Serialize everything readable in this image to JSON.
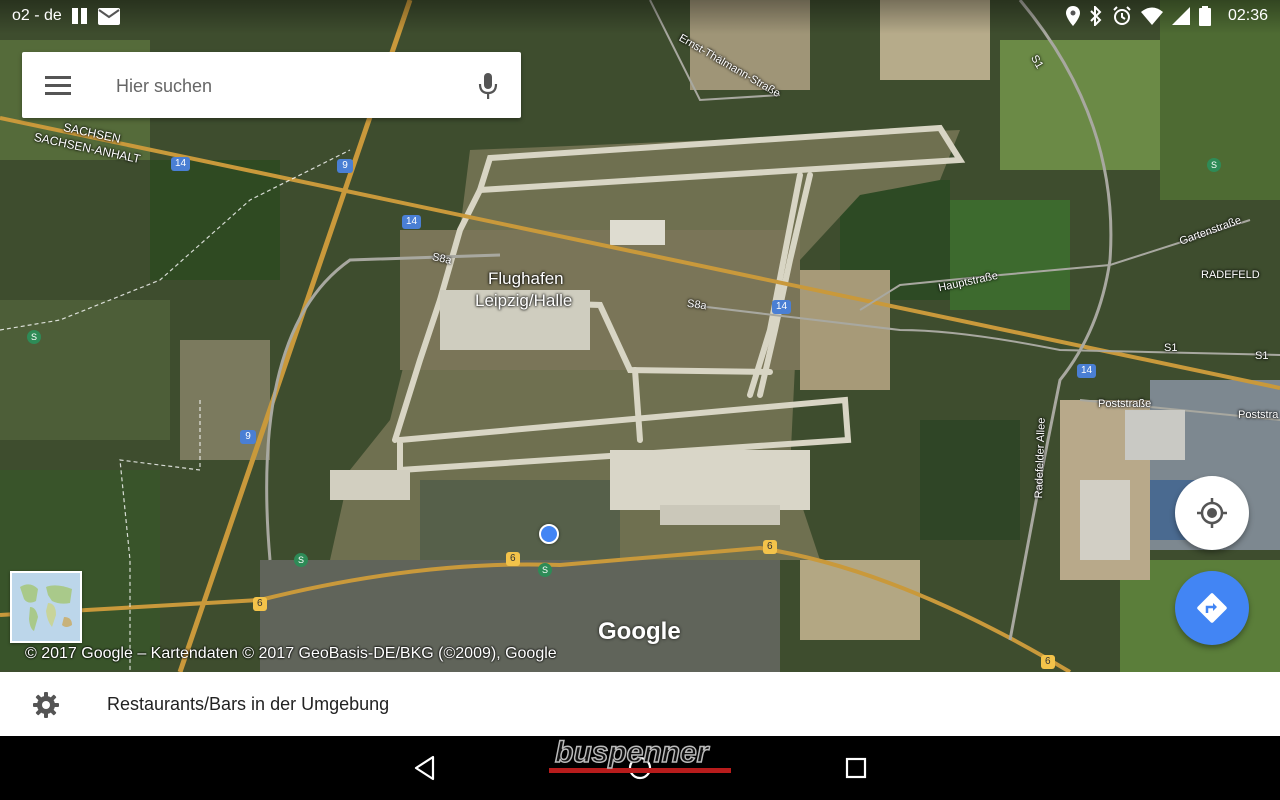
{
  "status_bar": {
    "carrier": "o2 - de",
    "time": "02:36",
    "icons": [
      "sim-icon",
      "mail-icon",
      "location-icon",
      "bluetooth-icon",
      "alarm-icon",
      "wifi-icon",
      "signal-icon",
      "battery-icon"
    ]
  },
  "search": {
    "placeholder": "Hier suchen",
    "value": "",
    "menu_icon": "menu-icon",
    "mic_icon": "mic-icon"
  },
  "map": {
    "labels": {
      "sachsen": "SACHSEN",
      "sachsen_anhalt": "SACHSEN-ANHALT",
      "airport_line1": "Flughafen",
      "airport_line2": "Leipzig/Halle",
      "ernst_thaelmann": "Ernst-Thälmann-Straße",
      "gartenstrasse": "Gartenstraße",
      "radefeld": "RADEFELD",
      "hauptstrasse": "Hauptstraße",
      "poststrasse_1": "Poststraße",
      "poststrasse_2": "Poststra",
      "radefelder_allee": "Radefelder Allee",
      "s8a_1": "S8a",
      "s8a_2": "S8a",
      "s1_top": "S1",
      "s1_right": "S1",
      "s1_edge": "S1"
    },
    "shields": {
      "b14_a": "14",
      "b14_b": "14",
      "b14_c": "14",
      "b14_d": "14",
      "a9_a": "9",
      "a9_b": "9",
      "b6_a": "6",
      "b6_b": "6",
      "b6_c": "6",
      "b6_d": "6",
      "s_a": "S",
      "s_b": "S",
      "s_c": "S",
      "s_d": "S"
    },
    "brand": "Google",
    "copyright": "© 2017 Google – Kartendaten © 2017 GeoBasis-DE/BKG (©2009), Google"
  },
  "controls": {
    "my_location_icon": "crosshair-icon",
    "directions_icon": "directions-icon",
    "accent": "#4285f4"
  },
  "bottom_sheet": {
    "label": "Restaurants/Bars in der Umgebung",
    "icon": "gear-icon"
  },
  "watermark": {
    "text": "buspenner"
  },
  "nav_bar": {
    "back_icon": "back-icon",
    "home_icon": "home-icon",
    "recents_icon": "recents-icon"
  }
}
